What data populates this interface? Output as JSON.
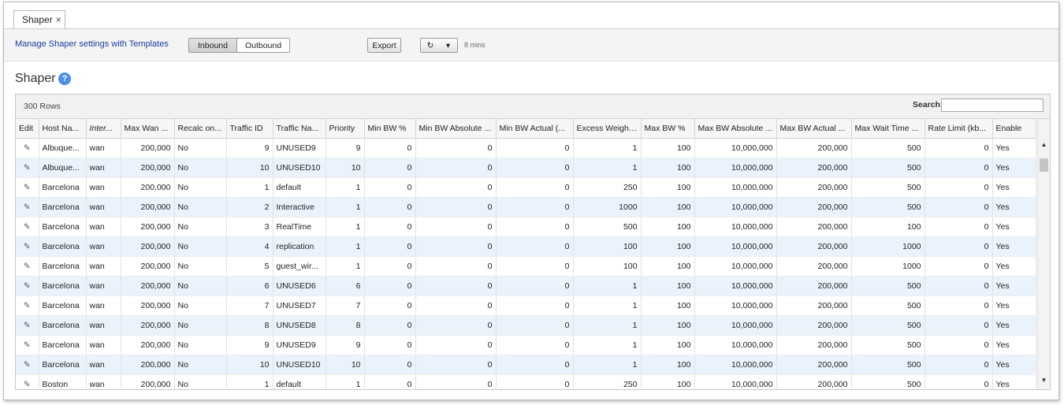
{
  "tab": {
    "label": "Shaper",
    "close_glyph": "×"
  },
  "toolbar": {
    "templates_link": "Manage Shaper settings with Templates",
    "inbound_label": "Inbound",
    "outbound_label": "Outbound",
    "export_label": "Export",
    "refresh_glyph": "↻",
    "menu_glyph": "▾",
    "refresh_interval": "8 mins"
  },
  "page": {
    "title": "Shaper",
    "help_glyph": "?"
  },
  "grid": {
    "row_count": "300 Rows",
    "search_label": "Search",
    "search_value": "",
    "edit_glyph": "✎",
    "columns": [
      "Edit",
      "Host Na...",
      "Inter...",
      "Max Wan ...",
      "Recalc on...",
      "Traffic ID",
      "Traffic Na...",
      "Priority",
      "Min BW %",
      "Min BW Absolute ...",
      "Min BW Actual (...",
      "Excess Weight...",
      "Max BW %",
      "Max BW Absolute ...",
      "Max BW Actual ...",
      "Max Wait Time ...",
      "Rate Limit (kb...",
      "Enable"
    ],
    "rows": [
      [
        "Albuque...",
        "wan",
        "200,000",
        "No",
        "9",
        "UNUSED9",
        "9",
        "0",
        "0",
        "0",
        "1",
        "100",
        "10,000,000",
        "200,000",
        "500",
        "0",
        "Yes"
      ],
      [
        "Albuque...",
        "wan",
        "200,000",
        "No",
        "10",
        "UNUSED10",
        "10",
        "0",
        "0",
        "0",
        "1",
        "100",
        "10,000,000",
        "200,000",
        "500",
        "0",
        "Yes"
      ],
      [
        "Barcelona",
        "wan",
        "200,000",
        "No",
        "1",
        "default",
        "1",
        "0",
        "0",
        "0",
        "250",
        "100",
        "10,000,000",
        "200,000",
        "500",
        "0",
        "Yes"
      ],
      [
        "Barcelona",
        "wan",
        "200,000",
        "No",
        "2",
        "Interactive",
        "1",
        "0",
        "0",
        "0",
        "1000",
        "100",
        "10,000,000",
        "200,000",
        "500",
        "0",
        "Yes"
      ],
      [
        "Barcelona",
        "wan",
        "200,000",
        "No",
        "3",
        "RealTime",
        "1",
        "0",
        "0",
        "0",
        "500",
        "100",
        "10,000,000",
        "200,000",
        "100",
        "0",
        "Yes"
      ],
      [
        "Barcelona",
        "wan",
        "200,000",
        "No",
        "4",
        "replication",
        "1",
        "0",
        "0",
        "0",
        "100",
        "100",
        "10,000,000",
        "200,000",
        "1000",
        "0",
        "Yes"
      ],
      [
        "Barcelona",
        "wan",
        "200,000",
        "No",
        "5",
        "guest_wir...",
        "1",
        "0",
        "0",
        "0",
        "100",
        "100",
        "10,000,000",
        "200,000",
        "1000",
        "0",
        "Yes"
      ],
      [
        "Barcelona",
        "wan",
        "200,000",
        "No",
        "6",
        "UNUSED6",
        "6",
        "0",
        "0",
        "0",
        "1",
        "100",
        "10,000,000",
        "200,000",
        "500",
        "0",
        "Yes"
      ],
      [
        "Barcelona",
        "wan",
        "200,000",
        "No",
        "7",
        "UNUSED7",
        "7",
        "0",
        "0",
        "0",
        "1",
        "100",
        "10,000,000",
        "200,000",
        "500",
        "0",
        "Yes"
      ],
      [
        "Barcelona",
        "wan",
        "200,000",
        "No",
        "8",
        "UNUSED8",
        "8",
        "0",
        "0",
        "0",
        "1",
        "100",
        "10,000,000",
        "200,000",
        "500",
        "0",
        "Yes"
      ],
      [
        "Barcelona",
        "wan",
        "200,000",
        "No",
        "9",
        "UNUSED9",
        "9",
        "0",
        "0",
        "0",
        "1",
        "100",
        "10,000,000",
        "200,000",
        "500",
        "0",
        "Yes"
      ],
      [
        "Barcelona",
        "wan",
        "200,000",
        "No",
        "10",
        "UNUSED10",
        "10",
        "0",
        "0",
        "0",
        "1",
        "100",
        "10,000,000",
        "200,000",
        "500",
        "0",
        "Yes"
      ],
      [
        "Boston",
        "wan",
        "200,000",
        "No",
        "1",
        "default",
        "1",
        "0",
        "0",
        "0",
        "250",
        "100",
        "10,000,000",
        "200,000",
        "500",
        "0",
        "Yes"
      ]
    ],
    "scroll_up_glyph": "▲",
    "scroll_down_glyph": "▼"
  }
}
